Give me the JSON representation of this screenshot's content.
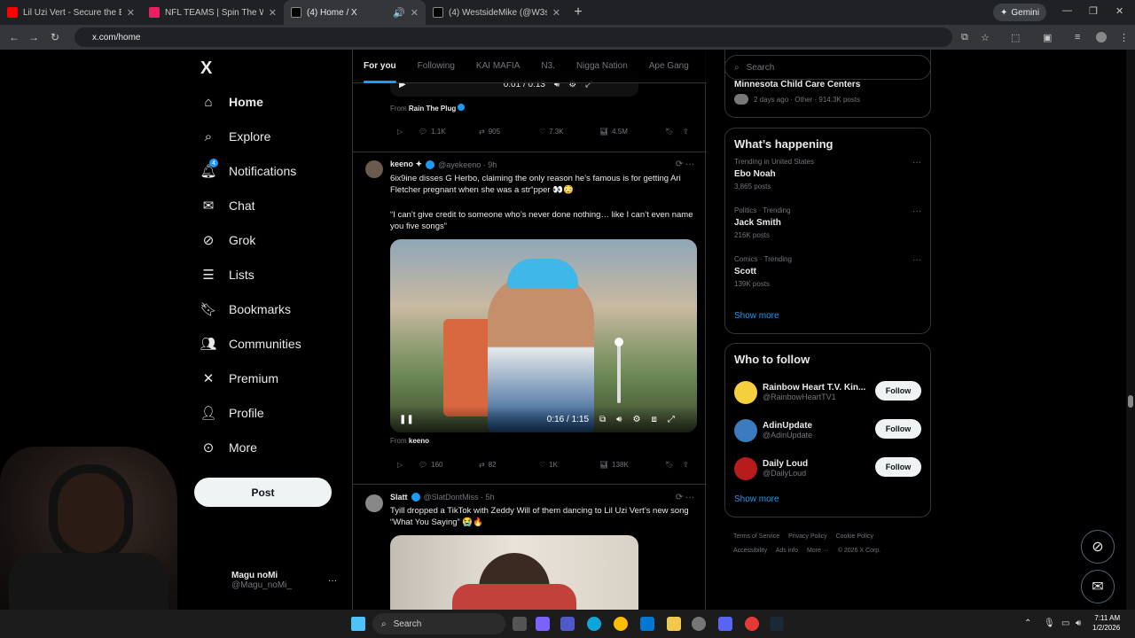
{
  "browser": {
    "tabs": [
      {
        "title": "Lil Uzi Vert - Secure the Bag [O",
        "color": "#ff0000"
      },
      {
        "title": "NFL TEAMS | Spin The Wheel - ",
        "color": "#e91e63"
      },
      {
        "title": "(4) Home / X",
        "color": "#000000"
      },
      {
        "title": "(4) WestsideMike (@W3stside",
        "color": "#000000"
      }
    ],
    "gemini_label": "Gemini",
    "url": "x.com/home"
  },
  "sidebar": {
    "logo": "X",
    "items": [
      {
        "label": "Home",
        "icon": "home-icon"
      },
      {
        "label": "Explore",
        "icon": "search-icon"
      },
      {
        "label": "Notifications",
        "icon": "bell-icon",
        "badge": "4"
      },
      {
        "label": "Chat",
        "icon": "mail-icon"
      },
      {
        "label": "Grok",
        "icon": "grok-icon"
      },
      {
        "label": "Lists",
        "icon": "list-icon"
      },
      {
        "label": "Bookmarks",
        "icon": "bookmark-icon"
      },
      {
        "label": "Communities",
        "icon": "people-icon"
      },
      {
        "label": "Premium",
        "icon": "x-icon"
      },
      {
        "label": "Profile",
        "icon": "person-icon"
      },
      {
        "label": "More",
        "icon": "more-circle-icon"
      }
    ],
    "post_label": "Post",
    "account": {
      "name": "Magu noMi",
      "handle": "@Magu_noMi_"
    }
  },
  "feed": {
    "tabs": [
      "For you",
      "Following",
      "KAI MAFIA",
      "N3.",
      "Nigga Nation",
      "Ape Gang"
    ],
    "top_video": {
      "time": "0:01 / 0:13"
    },
    "top_from": {
      "prefix": "From",
      "name": "Rain The Plug"
    },
    "top_actions": {
      "replies": "1.1K",
      "reposts": "905",
      "likes": "7.3K",
      "views": "4.5M"
    },
    "tweet1": {
      "name": "keeno ✦",
      "handle": "@ayekeeno · 9h",
      "text1": "6ix9ine disses G Herbo, claiming the only reason he’s famous is for getting Ari Fletcher pregnant when she was a str“pper 👀😳",
      "text2": "“I can’t give credit to someone who’s never done nothing… like I can’t even name you five songs”",
      "video_time": "0:16 / 1:15",
      "from_prefix": "From",
      "from_name": "keeno",
      "actions": {
        "replies": "160",
        "reposts": "82",
        "likes": "1K",
        "views": "138K"
      }
    },
    "tweet2": {
      "name": "Slatt",
      "handle": "@SlatDontMiss · 5h",
      "text": "Tyill dropped a TikTok with Zeddy Will of them dancing to Lil Uzi Vert’s new song “What You Saying” 😭🔥"
    }
  },
  "right": {
    "search_placeholder": "Search",
    "prev_card": {
      "title": "Minnesota Child Care Centers",
      "meta": "2 days ago · Other · 914.3K posts"
    },
    "happening": {
      "title": "What’s happening",
      "trends": [
        {
          "context": "Trending in United States",
          "topic": "Ebo Noah",
          "posts": "3,865 posts"
        },
        {
          "context": "Politics · Trending",
          "topic": "Jack Smith",
          "posts": "216K posts"
        },
        {
          "context": "Comics · Trending",
          "topic": "Scott",
          "posts": "139K posts"
        }
      ],
      "show_more": "Show more"
    },
    "who_to_follow": {
      "title": "Who to follow",
      "accounts": [
        {
          "name": "Rainbow Heart T.V. Kin...",
          "handle": "@RainbowHeartTV1",
          "color": "#f4d03f"
        },
        {
          "name": "AdinUpdate",
          "handle": "@AdinUpdate",
          "color": "#3b7bbf"
        },
        {
          "name": "Daily Loud",
          "handle": "@DailyLoud",
          "color": "#b71c1c"
        }
      ],
      "follow_label": "Follow",
      "show_more": "Show more"
    },
    "footer": [
      "Terms of Service",
      "Privacy Policy",
      "Cookie Policy",
      "Accessibility",
      "Ads info",
      "More ···",
      "© 2026 X Corp."
    ]
  },
  "taskbar": {
    "search_label": "Search",
    "time": "7:11 AM",
    "date": "1/2/2026"
  }
}
